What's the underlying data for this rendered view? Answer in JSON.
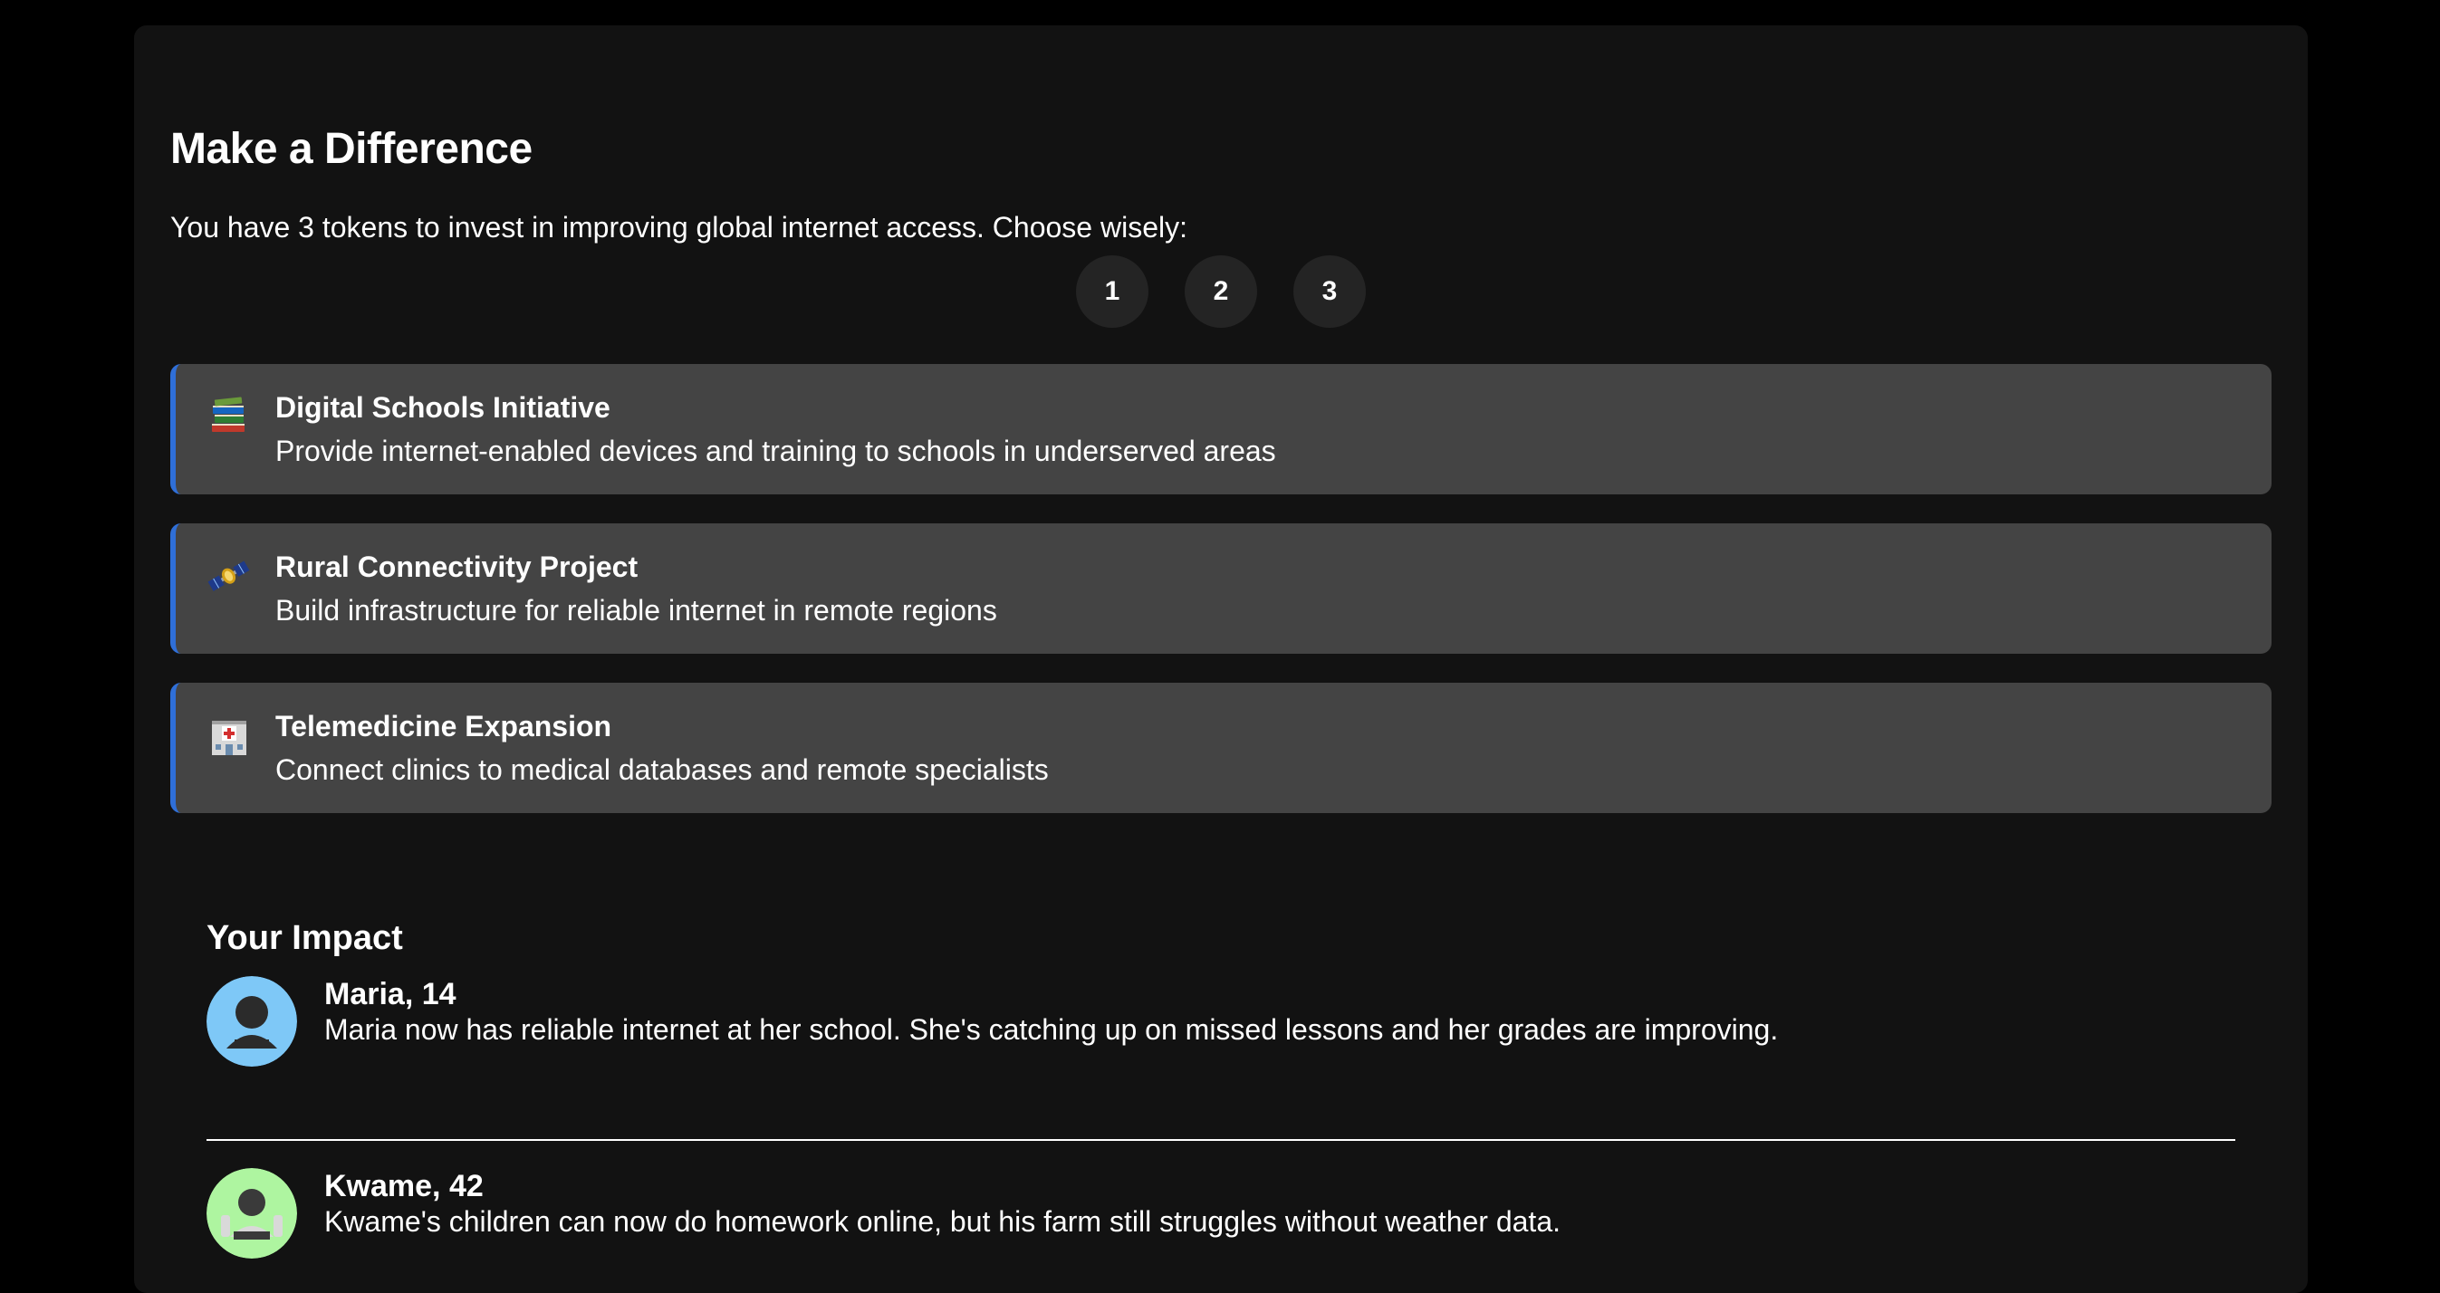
{
  "header": {
    "title": "Make a Difference",
    "intro": "You have 3 tokens to invest in improving global internet access. Choose wisely:"
  },
  "tokens": [
    {
      "label": "1"
    },
    {
      "label": "2"
    },
    {
      "label": "3"
    }
  ],
  "projects": [
    {
      "icon": "books-icon",
      "name": "Digital Schools Initiative",
      "description": "Provide internet-enabled devices and training to schools in underserved areas"
    },
    {
      "icon": "satellite-icon",
      "name": "Rural Connectivity Project",
      "description": "Build infrastructure for reliable internet in remote regions"
    },
    {
      "icon": "hospital-icon",
      "name": "Telemedicine Expansion",
      "description": "Connect clinics to medical databases and remote specialists"
    }
  ],
  "impact": {
    "title": "Your Impact",
    "people": [
      {
        "name": "Maria, 14",
        "story": "Maria now has reliable internet at her school. She's catching up on missed lessons and her grades are improving.",
        "avatar_color": "#7ec8f7"
      },
      {
        "name": "Kwame, 42",
        "story": "Kwame's children can now do homework online, but his farm still struggles without weather data.",
        "avatar_color": "#aef5a0"
      }
    ]
  },
  "colors": {
    "background": "#000000",
    "panel": "#121212",
    "card": "#444444",
    "accent": "#2f6fd8",
    "token": "#242424"
  }
}
